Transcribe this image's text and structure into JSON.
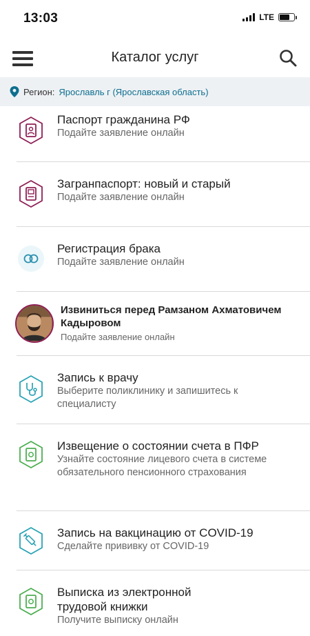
{
  "status_bar": {
    "time": "13:03",
    "network": "LTE"
  },
  "header": {
    "title": "Каталог услуг",
    "menu_icon": "hamburger-menu-icon",
    "search_icon": "search-icon"
  },
  "region": {
    "label": "Регион:",
    "value": "Ярославль г (Ярославская область)"
  },
  "services": [
    {
      "title": "Паспорт гражданина РФ",
      "subtitle": "Подайте заявление онлайн",
      "icon": "passport-icon",
      "color": "#8e1f55"
    },
    {
      "title": "Загранпаспорт: новый и старый",
      "subtitle": "Подайте заявление онлайн",
      "icon": "foreign-passport-icon",
      "color": "#8e1f55"
    },
    {
      "title": "Регистрация брака",
      "subtitle": "Подайте заявление онлайн",
      "icon": "wedding-rings-icon",
      "color": "#2a8fb0"
    },
    {
      "title": "Извиниться перед Рамзаном Ахматовичем Кадыровом",
      "subtitle": "Подайте заявление онлайн",
      "icon": "portrait-avatar",
      "color": "#8e1f55"
    },
    {
      "title": "Запись к врачу",
      "subtitle": "Выберите поликлинику и запишитесь к специалисту",
      "icon": "stethoscope-icon",
      "color": "#2aa3b5"
    },
    {
      "title": "Извещение о состоянии счета в ПФР",
      "subtitle": "Узнайте состояние лицевого счета в системе обязательного пенсионного страхования",
      "icon": "pension-document-icon",
      "color": "#4caf50"
    },
    {
      "title": "Запись на вакцинацию от COVID-19",
      "subtitle": "Сделайте прививку от COVID-19",
      "icon": "syringe-icon",
      "color": "#2aa3b5"
    },
    {
      "title": "Выписка из электронной трудовой книжки",
      "subtitle": "Получите выписку онлайн",
      "icon": "work-book-icon",
      "color": "#4caf50"
    }
  ]
}
